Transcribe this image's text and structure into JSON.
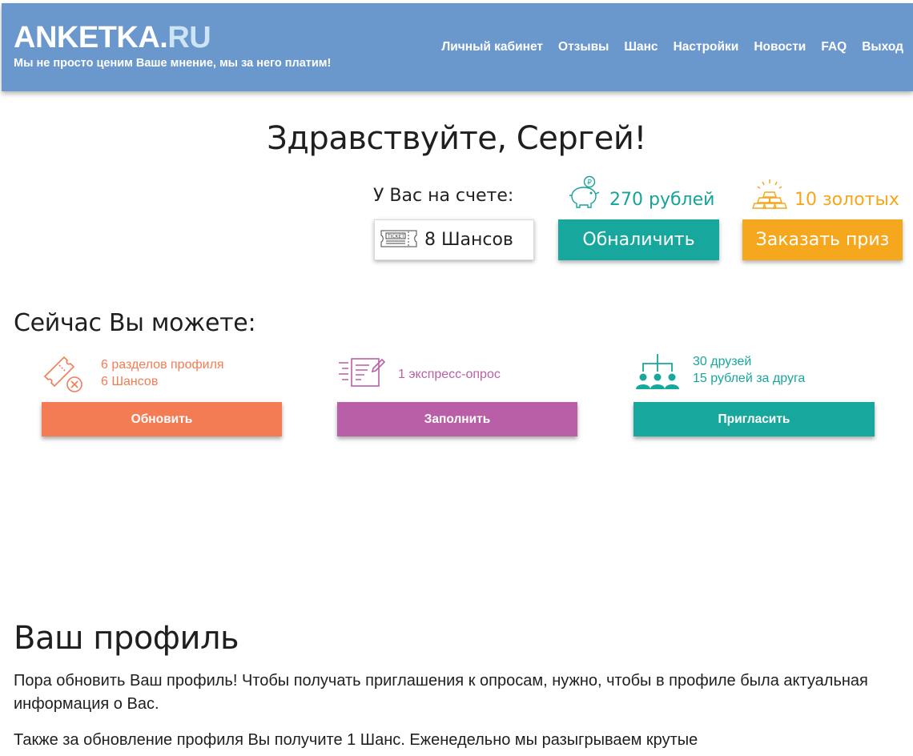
{
  "header": {
    "brand_main": "ANKETKA.",
    "brand_suffix": "RU",
    "tagline": "Мы не просто ценим Ваше мнение, мы за него платим!",
    "nav": [
      "Личный кабинет",
      "Отзывы",
      "Шанс",
      "Настройки",
      "Новости",
      "FAQ",
      "Выход"
    ]
  },
  "greeting": "Здравствуйте, Сергей!",
  "balance": {
    "label": "У Вас на счете:",
    "money": "270 рублей",
    "gold": "10 золотых",
    "chances": "8 Шансов",
    "ticket_text": "TICKET",
    "cash_button": "Обналичить",
    "prize_button": "Заказать приз"
  },
  "now": {
    "title": "Сейчас Вы можете:",
    "cards": [
      {
        "line1": "6 разделов профиля",
        "line2": "6 Шансов",
        "button": "Обновить",
        "color": "#f47c55",
        "icon": "ticket-cross-icon"
      },
      {
        "line1": "1 экспресс-опрос",
        "line2": "",
        "button": "Заполнить",
        "color": "#b95fa8",
        "icon": "survey-form-icon"
      },
      {
        "line1": "30 друзей",
        "line2": "15 рублей за друга",
        "button": "Пригласить",
        "color": "#18a79c",
        "icon": "people-network-icon"
      }
    ]
  },
  "profile": {
    "title": "Ваш профиль",
    "paragraph1": "Пора обновить Ваш профиль! Чтобы получать приглашения к опросам, нужно, чтобы в профиле была актуальная информация о Вас.",
    "paragraph2": "Также за обновление профиля Вы получите 1 Шанс. Еженедельно мы разыгрываем крутые"
  },
  "colors": {
    "header_bg": "#6a97cc",
    "teal": "#18a79c",
    "orange": "#f5a81e",
    "coral": "#f47c55",
    "purple": "#b95fa8"
  }
}
